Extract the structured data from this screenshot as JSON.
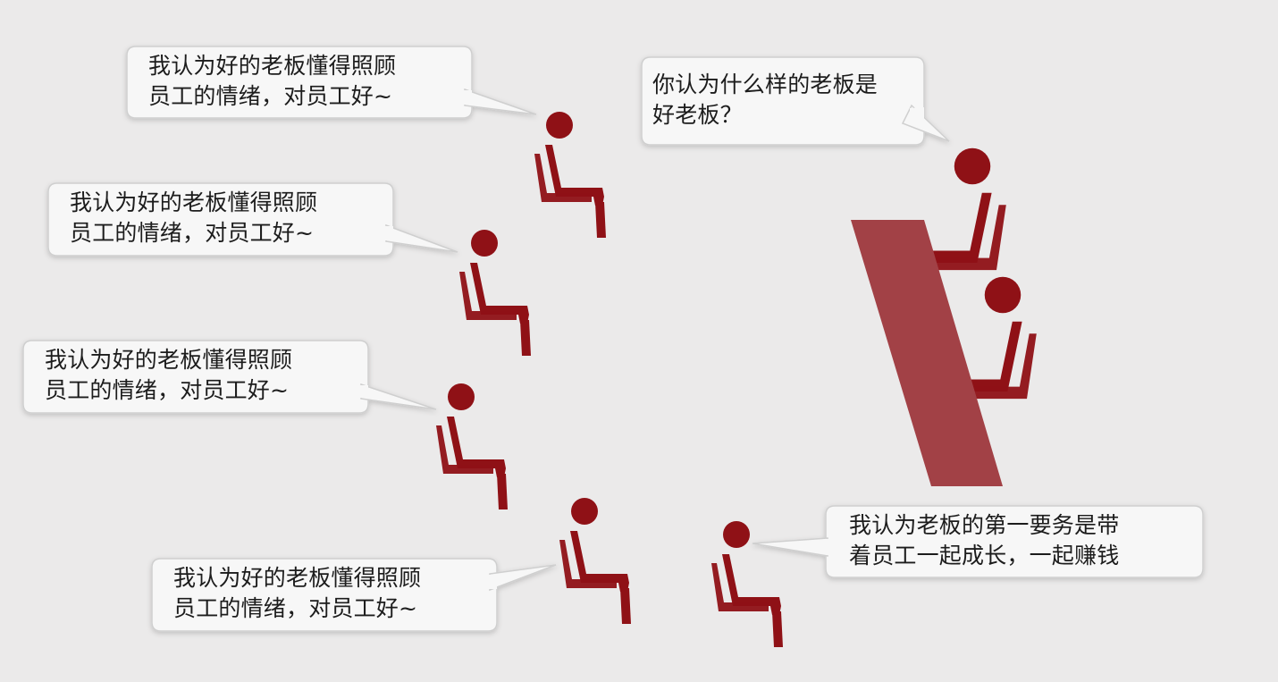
{
  "colors": {
    "background": "#ebeaea",
    "figure": "#8f1116",
    "table": "#a24146",
    "bubble_fill": "#f7f7f7",
    "bubble_stroke": "#cfcfcf",
    "text": "#1c1c1c"
  },
  "bubbles": {
    "boss_question": {
      "line1": "你认为什么样的老板是",
      "line2": "好老板？"
    },
    "staff_1": {
      "line1": "我认为好的老板懂得照顾",
      "line2": "员工的情绪，对员工好~"
    },
    "staff_2": {
      "line1": "我认为好的老板懂得照顾",
      "line2": "员工的情绪，对员工好~"
    },
    "staff_3": {
      "line1": "我认为好的老板懂得照顾",
      "line2": "员工的情绪，对员工好~"
    },
    "staff_4": {
      "line1": "我认为好的老板懂得照顾",
      "line2": "员工的情绪，对员工好~"
    },
    "staff_5": {
      "line1": "我认为老板的第一要务是带",
      "line2": "着员工一起成长，一起赚钱"
    }
  },
  "icons": {
    "seated_person": "seated-person-icon",
    "table": "table-icon"
  }
}
